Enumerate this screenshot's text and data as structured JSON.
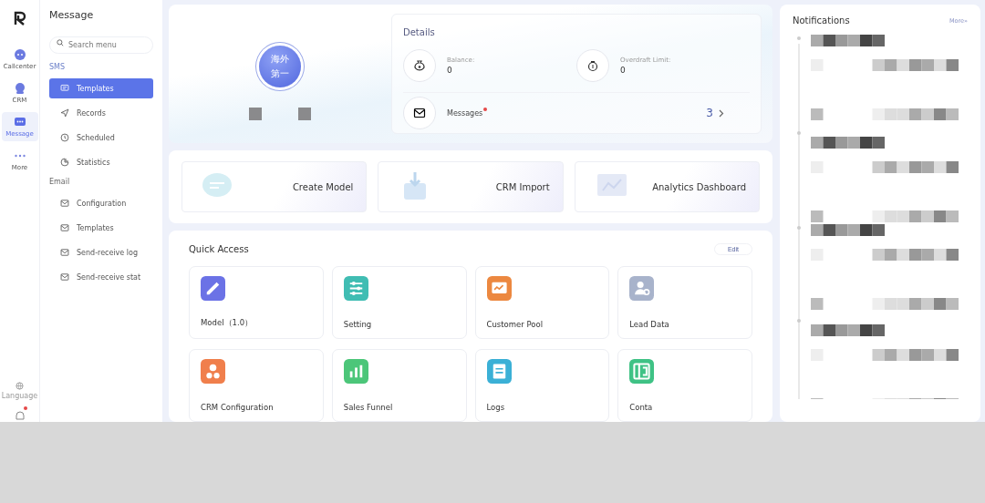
{
  "rail": {
    "items": [
      {
        "label": "Callcenter",
        "selected": false
      },
      {
        "label": "CRM",
        "selected": false
      },
      {
        "label": "Message",
        "selected": true
      },
      {
        "label": "More",
        "selected": false
      }
    ],
    "language": "Language",
    "bell_alert": true
  },
  "sidebar": {
    "title": "Message",
    "search": {
      "placeholder": "Search menu"
    },
    "groups": [
      {
        "label": "SMS",
        "items": [
          {
            "label": "Templates",
            "selected": true
          },
          {
            "label": "Records",
            "selected": false
          },
          {
            "label": "Scheduled",
            "selected": false
          },
          {
            "label": "Statistics",
            "selected": false
          }
        ]
      },
      {
        "label": "Email",
        "items": [
          {
            "label": "Configuration",
            "selected": false
          },
          {
            "label": "Templates",
            "selected": false
          },
          {
            "label": "Send-receive log",
            "selected": false
          },
          {
            "label": "Send-receive stat",
            "selected": false
          }
        ]
      }
    ]
  },
  "hero": {
    "badge_line_1": "海外",
    "badge_line_2": "第一"
  },
  "details": {
    "title": "Details",
    "balance": {
      "label": "Balance:",
      "value": "0"
    },
    "overdraft": {
      "label": "Overdraft Limit:",
      "value": "0"
    },
    "messages": {
      "label": "Messages",
      "unread": true,
      "count": "3"
    }
  },
  "shortcuts": [
    {
      "label": "Create Model"
    },
    {
      "label": "CRM Import"
    },
    {
      "label": "Analytics Dashboard"
    }
  ],
  "quick_access": {
    "title": "Quick Access",
    "edit": "Edit",
    "items": [
      {
        "label": "Model（1.0）",
        "color": "#6b72e6"
      },
      {
        "label": "Setting",
        "color": "#40bdb3"
      },
      {
        "label": "Customer Pool",
        "color": "#ec8840"
      },
      {
        "label": "Lead Data",
        "color": "#a8b3cb"
      },
      {
        "label": "CRM Configuration",
        "color": "#f07f4c"
      },
      {
        "label": "Sales Funnel",
        "color": "#4cc679"
      },
      {
        "label": "Logs",
        "color": "#3bb0d6"
      },
      {
        "label": "Conta",
        "color": "#3fc285"
      }
    ]
  },
  "notifications": {
    "title": "Notifications",
    "more": "More»"
  }
}
